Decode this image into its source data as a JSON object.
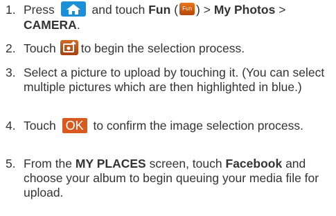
{
  "steps": [
    {
      "num": "1.",
      "pre": "Press",
      "mid": "and touch",
      "fun": "Fun",
      "paren_open": "(",
      "fun_icon_text": "Fun",
      "paren_close": ")",
      "sep1": ">",
      "my_photos": "My Photos",
      "sep2": ">",
      "camera": "CAMERA",
      "end": "."
    },
    {
      "num": "2.",
      "pre": "Touch",
      "post": "to begin the selection process."
    },
    {
      "num": "3.",
      "text": "Select a picture to upload by touching it. (You can select multiple pictures which are then highlighted in blue.)"
    },
    {
      "num": "4.",
      "pre": "Touch",
      "ok": "OK",
      "post": "to confirm the image selection process."
    },
    {
      "num": "5.",
      "pre": "From the",
      "my_places": "MY PLACES",
      "mid": "screen, touch",
      "facebook": "Facebook",
      "post": "and choose your album to begin queuing your media file for upload."
    }
  ],
  "icons": {
    "home": "home-icon",
    "fun": "fun-icon",
    "upload": "upload-icon"
  },
  "colors": {
    "text": "#333333",
    "home_icon_bg": "#1d8fd6",
    "accent_orange": "#d95a1e"
  }
}
